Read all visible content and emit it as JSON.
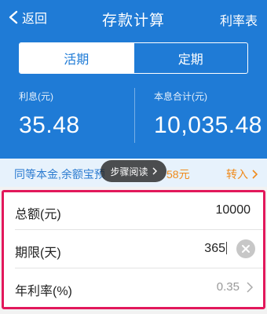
{
  "header": {
    "back_label": "返回",
    "title": "存款计算",
    "rate_table_label": "利率表"
  },
  "tabs": [
    {
      "label": "活期",
      "selected": true
    },
    {
      "label": "定期",
      "selected": false
    }
  ],
  "results": {
    "interest_label": "利息(元)",
    "interest_value": "35.48",
    "total_label": "本息合计(元)",
    "total_value": "10,035.48"
  },
  "promo": {
    "text": "同等本金,余额宝预",
    "amount": "58元",
    "transfer_label": "转入"
  },
  "toast": {
    "label": "步骤阅读"
  },
  "form": {
    "amount_label": "总额(元)",
    "amount_value": "10000",
    "term_label": "期限(天)",
    "term_value": "365",
    "rate_label": "年利率(%)",
    "rate_value": "0.35"
  },
  "colors": {
    "primary": "#1f7bd6",
    "accent_orange": "#f08a1a",
    "highlight_border": "#e2185b"
  },
  "icons": {
    "back": "chevron-left-icon",
    "toast_arrow": "chevron-right-icon",
    "transfer_arrow": "chevron-right-icon",
    "clear": "clear-circle-icon",
    "rate_arrow": "chevron-right-icon"
  }
}
